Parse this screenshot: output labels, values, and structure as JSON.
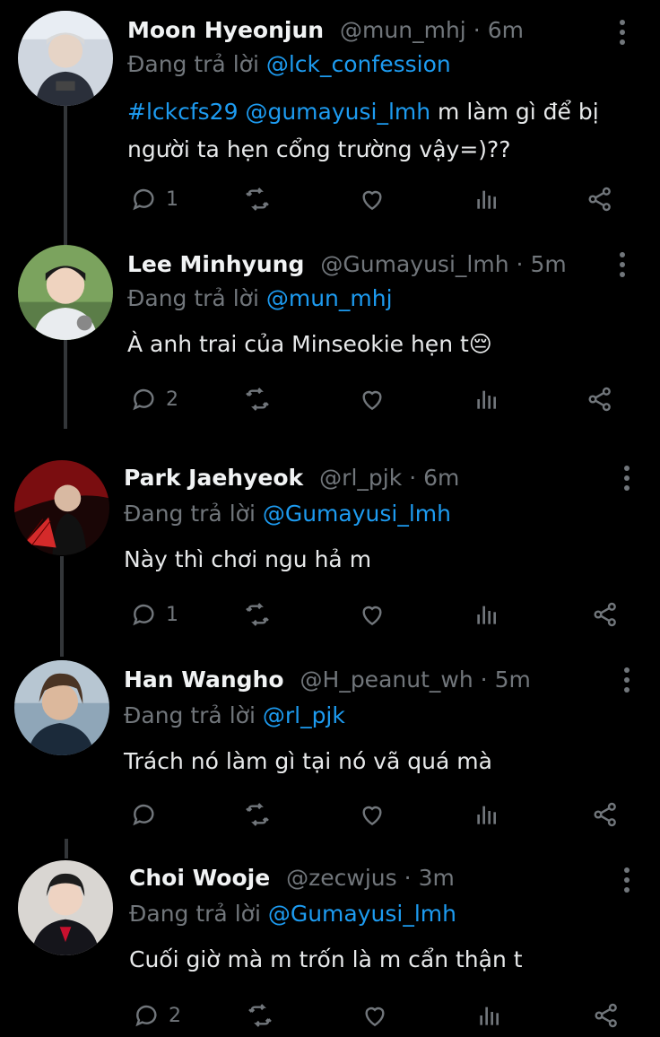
{
  "tweets": [
    {
      "name": "Moon Hyeonjun",
      "handle": "@mun_mhj",
      "time": "6m",
      "reply_prefix": "Đang trả lời",
      "reply_to": "@lck_confession",
      "text_parts": [
        {
          "t": "#lckcfs29",
          "link": true
        },
        {
          "t": " ",
          "link": false
        },
        {
          "t": "@gumayusi_lmh",
          "link": true
        },
        {
          "t": " m làm gì để bị",
          "link": false
        }
      ],
      "text_line2": "người ta hẹn cổng trường vậy=)??",
      "reply_count": "1"
    },
    {
      "name": "Lee Minhyung",
      "handle": "@Gumayusi_lmh",
      "time": "5m",
      "reply_prefix": "Đang trả lời",
      "reply_to": "@mun_mhj",
      "text": "À anh trai của Minseokie hẹn t😔",
      "reply_count": "2"
    },
    {
      "name": "Park Jaehyeok",
      "handle": "@rl_pjk",
      "time": "6m",
      "reply_prefix": "Đang trả lời",
      "reply_to": "@Gumayusi_lmh",
      "text": "Này thì chơi ngu hả m",
      "reply_count": "1"
    },
    {
      "name": "Han Wangho",
      "handle": "@H_peanut_wh",
      "time": "5m",
      "reply_prefix": "Đang trả lời",
      "reply_to": "@rl_pjk",
      "text": "Trách nó làm gì tại nó vã quá mà",
      "reply_count": ""
    },
    {
      "name": "Choi Wooje",
      "handle": "@zecwjus",
      "time": "3m",
      "reply_prefix": "Đang trả lời",
      "reply_to": "@Gumayusi_lmh",
      "text": "Cuối giờ mà m trốn là m cẩn thận t",
      "reply_count": "2"
    }
  ],
  "separator": "·",
  "colors": {
    "background": "#000000",
    "link": "#1d9bf0",
    "muted": "#71767b",
    "text": "#e7e9ea"
  },
  "icons": [
    "reply-icon",
    "retweet-icon",
    "like-icon",
    "views-icon",
    "share-icon",
    "more-icon"
  ]
}
